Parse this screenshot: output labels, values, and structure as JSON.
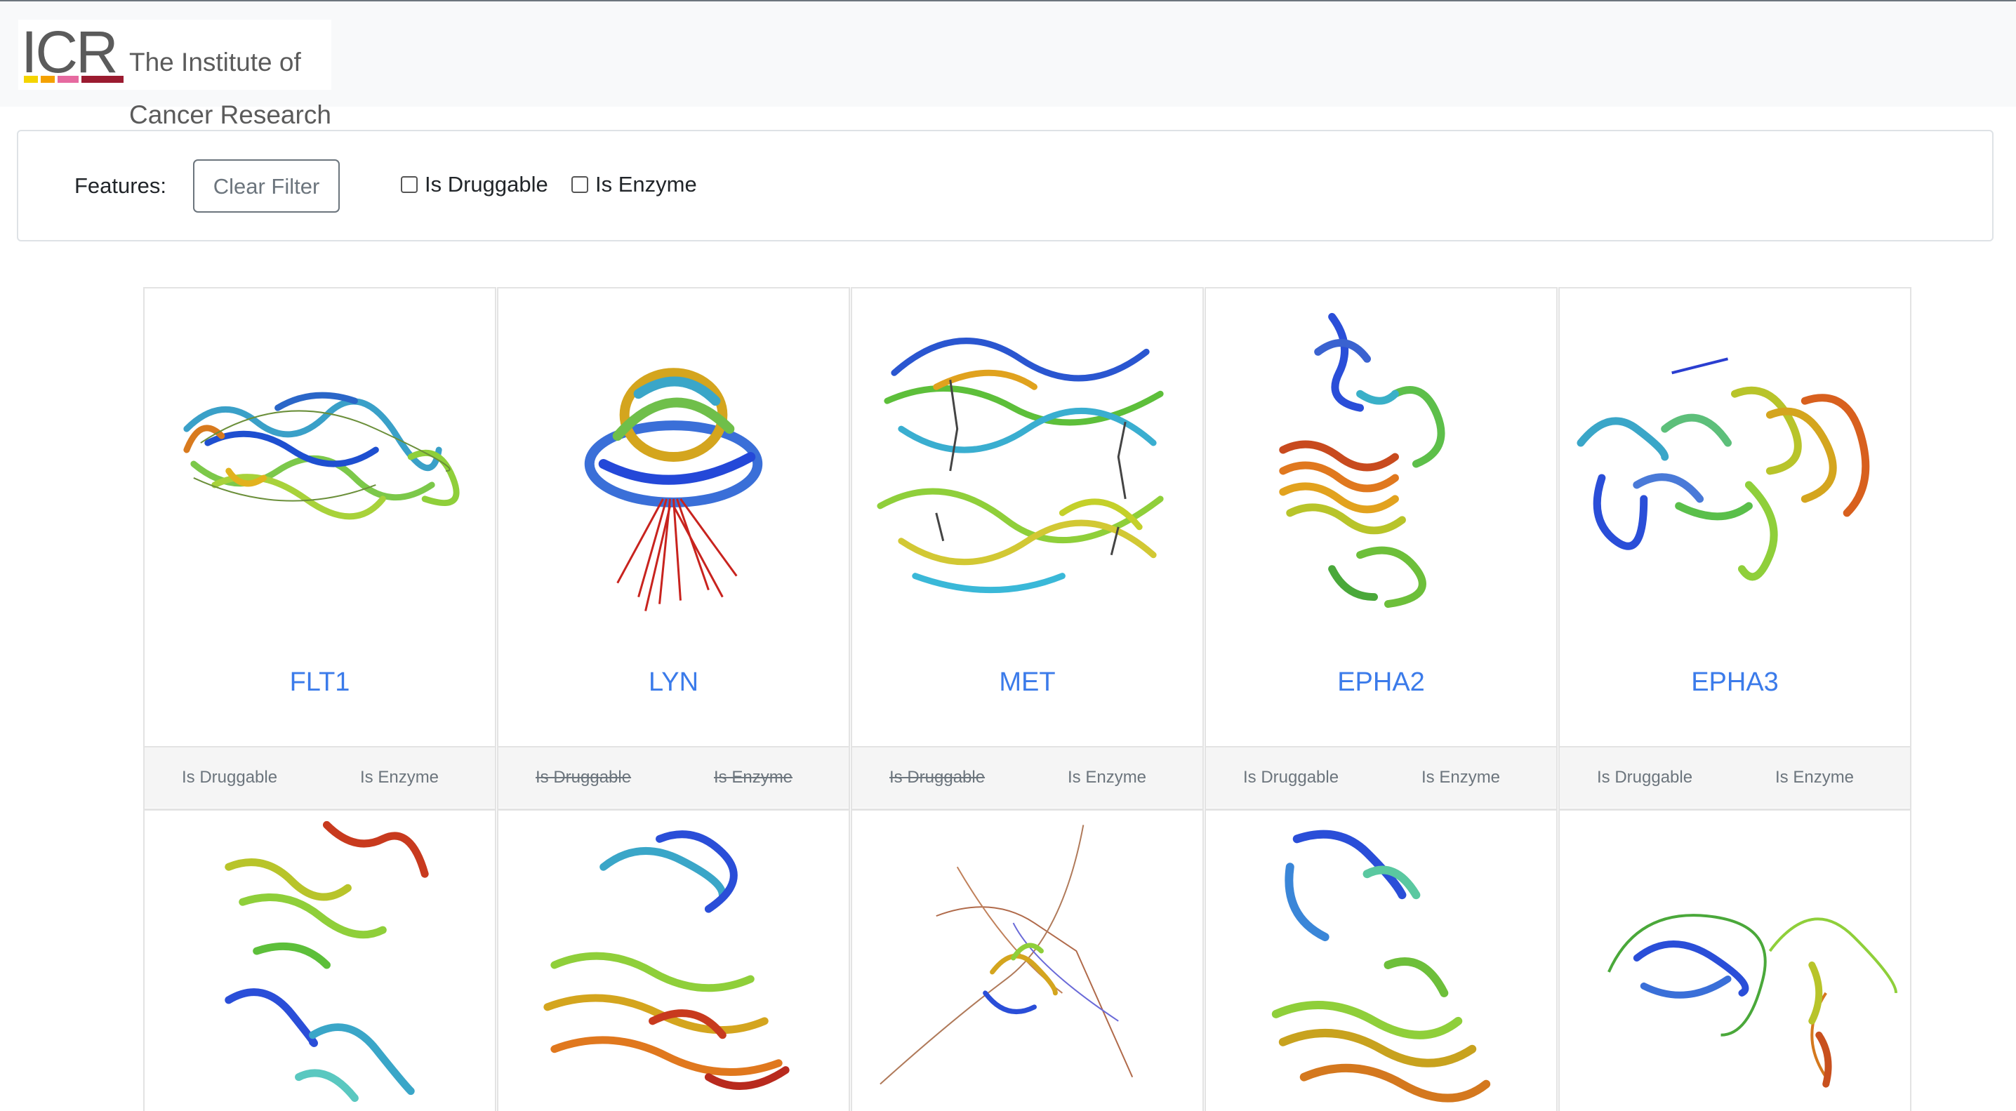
{
  "header": {
    "logo_mark": "ICR",
    "logo_line1": "The Institute of",
    "logo_line2": "Cancer Research",
    "logo_bar_colors": [
      "#f4d400",
      "#f4a100",
      "#e66aa0",
      "#9b1b30"
    ]
  },
  "filters": {
    "label": "Features:",
    "clear_label": "Clear Filter",
    "options": [
      {
        "label": "Is Druggable",
        "checked": false
      },
      {
        "label": "Is Enzyme",
        "checked": false
      }
    ]
  },
  "cards": [
    {
      "name": "FLT1",
      "druggable": {
        "label": "Is Druggable",
        "active": true
      },
      "enzyme": {
        "label": "Is Enzyme",
        "active": true
      },
      "structure_image": "protein-structure-flt1"
    },
    {
      "name": "LYN",
      "druggable": {
        "label": "Is Druggable",
        "active": false
      },
      "enzyme": {
        "label": "Is Enzyme",
        "active": false
      },
      "structure_image": "protein-structure-lyn"
    },
    {
      "name": "MET",
      "druggable": {
        "label": "Is Druggable",
        "active": false
      },
      "enzyme": {
        "label": "Is Enzyme",
        "active": true
      },
      "structure_image": "protein-structure-met"
    },
    {
      "name": "EPHA2",
      "druggable": {
        "label": "Is Druggable",
        "active": true
      },
      "enzyme": {
        "label": "Is Enzyme",
        "active": true
      },
      "structure_image": "protein-structure-epha2"
    },
    {
      "name": "EPHA3",
      "druggable": {
        "label": "Is Druggable",
        "active": true
      },
      "enzyme": {
        "label": "Is Enzyme",
        "active": true
      },
      "structure_image": "protein-structure-epha3"
    },
    {
      "name": "",
      "structure_image": "protein-structure-row2-1"
    },
    {
      "name": "",
      "structure_image": "protein-structure-row2-2"
    },
    {
      "name": "",
      "structure_image": "protein-structure-row2-3"
    },
    {
      "name": "",
      "structure_image": "protein-structure-row2-4"
    },
    {
      "name": "",
      "structure_image": "protein-structure-row2-5"
    }
  ]
}
